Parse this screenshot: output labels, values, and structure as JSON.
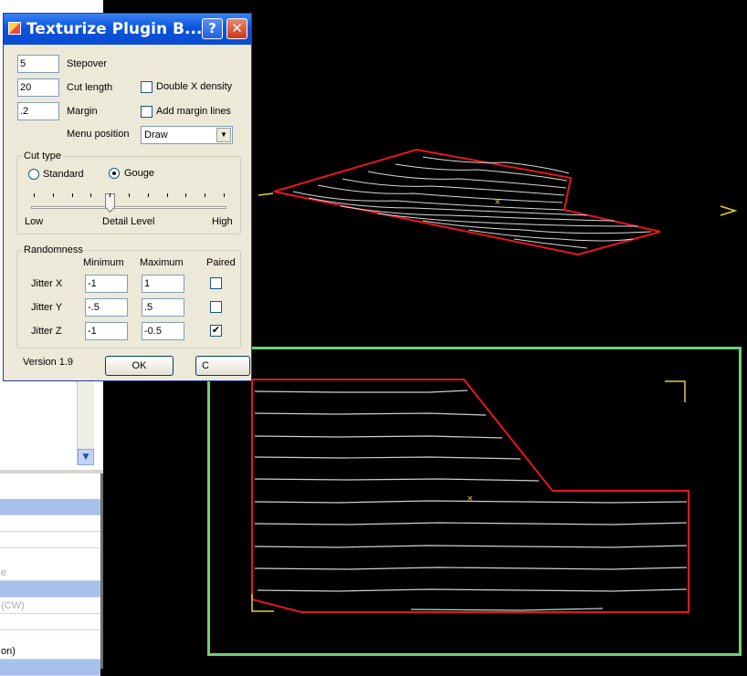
{
  "dialog": {
    "title": "Texturize Plugin B...",
    "help_glyph": "?",
    "close_glyph": "✕",
    "stepover": {
      "value": "5",
      "label": "Stepover"
    },
    "cut_length": {
      "value": "20",
      "label": "Cut length"
    },
    "margin": {
      "value": ".2",
      "label": "Margin"
    },
    "double_x_density": {
      "label": "Double X density",
      "checked": false
    },
    "add_margin_lines": {
      "label": "Add margin lines",
      "checked": false
    },
    "menu_position": {
      "label": "Menu position",
      "value": "Draw"
    },
    "cut_type": {
      "title": "Cut type",
      "standard_label": "Standard",
      "gouge_label": "Gouge",
      "selected": "Gouge",
      "slider_low": "Low",
      "slider_mid": "Detail Level",
      "slider_high": "High",
      "slider_level": 4,
      "slider_max": 10
    },
    "randomness": {
      "title": "Randomness",
      "col_min": "Minimum",
      "col_max": "Maximum",
      "col_paired": "Paired",
      "rows": [
        {
          "label": "Jitter X",
          "min": "-1",
          "max": "1",
          "paired": false
        },
        {
          "label": "Jitter Y",
          "min": "-.5",
          "max": ".5",
          "paired": false
        },
        {
          "label": "Jitter Z",
          "min": "-1",
          "max": "-0.5",
          "paired": true
        }
      ]
    },
    "version": "Version 1.9",
    "ok_label": "OK",
    "cancel_label": "C",
    "check_glyph": "✔"
  },
  "left_panel": {
    "rows": [
      "",
      "",
      "",
      "e",
      "",
      "(CW)",
      "",
      "on)",
      ""
    ],
    "scroll_glyph": "▼"
  },
  "colors": {
    "toolpath_outline": "#e8161b",
    "texture_lines": "#d9d9d9",
    "viewport_border": "#6fd26f",
    "marker": "#e0d040"
  }
}
